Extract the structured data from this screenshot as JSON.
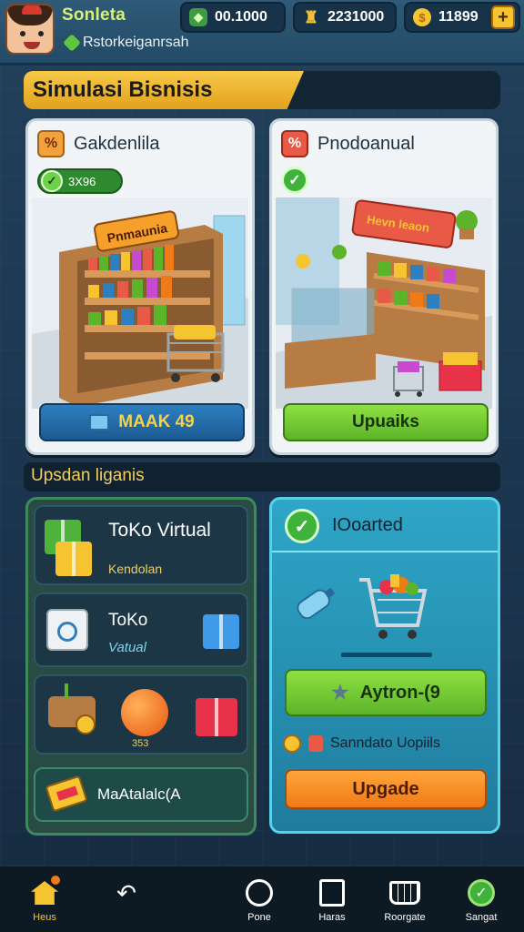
{
  "player": {
    "name": "Sonleta",
    "subtitle": "Rstorkeiganrsah"
  },
  "resources": {
    "cash": "00.1000",
    "trophies": "2231000",
    "coins": "11899",
    "plus_label": "+"
  },
  "section": {
    "title": "Simulasi Bisnisis"
  },
  "stores": [
    {
      "title": "Gakdenlila",
      "icon_letter": "%",
      "level": "3X96",
      "button": "MAAK 49"
    },
    {
      "title": "Pnodoanual",
      "icon_letter": "%",
      "button": "Upuaiks"
    }
  ],
  "upgrades": {
    "title": "Upsdan liganis",
    "tiles": [
      {
        "title": "ToKo Virtual",
        "subtitle": "Kendolan"
      },
      {
        "title": "ToKo",
        "subtitle": "Vatual"
      },
      {
        "number": "353"
      },
      {
        "title": "MaAtalalc(A"
      }
    ]
  },
  "detail": {
    "title": "IOoarted",
    "action_button": "Aytron-(9",
    "info_text": "Sanndato Uopiils",
    "upgrade_button": "Upgade"
  },
  "nav": [
    {
      "label": "Heus",
      "icon": "home-icon"
    },
    {
      "label": "",
      "icon": "back-icon"
    },
    {
      "label": "Pone",
      "icon": "circle-icon"
    },
    {
      "label": "Haras",
      "icon": "box-icon"
    },
    {
      "label": "Roorgate",
      "icon": "cart-icon"
    },
    {
      "label": "Sangat",
      "icon": "gear-icon"
    }
  ],
  "colors": {
    "accent_gold": "#f5c430",
    "accent_green": "#5cb42a",
    "accent_blue": "#1c5a92",
    "accent_orange": "#f07a16",
    "panel_cyan": "#2ea6c7"
  }
}
